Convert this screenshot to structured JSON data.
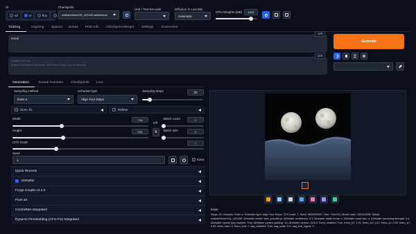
{
  "top": {
    "ui_label": "UI",
    "ui_options": [
      "sd",
      "xl",
      "flux",
      "all"
    ],
    "ui_selected": "xl",
    "checkpoint_label": "Checkpoint",
    "checkpoint_value": "realisticVisionV51_v51VAE.safetensors",
    "vae_label": "VAE / Text Encoder",
    "vae_value": "",
    "diffusion_label": "Diffusion in Low Bits",
    "diffusion_value": "Automatic",
    "gpu_label": "GPU Weights (MB)",
    "gpu_value": "4444",
    "gpu_fraction": 0.85
  },
  "main_tabs": [
    "Txt2img",
    "Img2img",
    "Spaces",
    "Extras",
    "PNG Info",
    "Checkpoint Merger",
    "Settings",
    "Extensions"
  ],
  "main_tab_active": 0,
  "prompt": {
    "value": "moon",
    "counter": "1/75",
    "negative_placeholder": "Negative prompt\n(Press Ctrl+Enter to generate, Alt+Enter to skip, Esc to interrupt)",
    "negative_counter": "0/75"
  },
  "generate_label": "Generate",
  "sub_tabs": [
    "Generation",
    "Textual Inversion",
    "Checkpoints",
    "Lora"
  ],
  "sub_tab_active": 0,
  "sampling": {
    "method_label": "Sampling method",
    "method_value": "Euler a",
    "schedule_label": "Schedule type",
    "schedule_value": "Align Your Steps",
    "steps_label": "Sampling steps",
    "steps_value": "20",
    "steps_fraction": 0.13
  },
  "hires_label": "Hires. fix",
  "refiner_label": "Refiner",
  "width": {
    "label": "Width",
    "value": "744",
    "fraction": 0.36
  },
  "height": {
    "label": "Height",
    "value": "752",
    "fraction": 0.37
  },
  "swap_label": "Off",
  "batch_count": {
    "label": "Batch count",
    "value": "1",
    "fraction": 0.0
  },
  "batch_size": {
    "label": "Batch size",
    "value": "1",
    "fraction": 0.0
  },
  "cfg": {
    "label": "CFG Scale",
    "value": "7",
    "fraction": 0.23
  },
  "seed": {
    "label": "Seed",
    "value": "-1",
    "extra_label": "Extra"
  },
  "accordions": [
    {
      "label": "Quick Recents",
      "checkbox": false
    },
    {
      "label": "ADetailer",
      "checkbox": true
    },
    {
      "label": "Forge Couple v3.2.0",
      "checkbox": false
    },
    {
      "label": "Pixel art",
      "checkbox": false
    },
    {
      "label": "ControlNet Integrated",
      "checkbox": false
    },
    {
      "label": "DynamicThresholding (CFG-Fix) Integrated",
      "checkbox": false
    }
  ],
  "output": {
    "prompt_text": "moon",
    "params_text": "Steps: 20, Sampler: Euler a, Schedule type: Align Your Steps, CFG scale: 7, Seed: 3632950547, Size: 744x752, Model hash: 15012c538f, Model: realisticVisionV51_v51VAE, ADetailer model: face_yolov8n.pt, ADetailer confidence: 0.3, ADetailer dilate erode: 4, ADetailer mask blur: 4, ADetailer denoising strength: 0.4, ADetailer inpaint only masked: True, ADetailer inpaint padding: 32, ADetailer version: 24.6.0, freeu_enabled: True, freeu_b1: 1.01, freeu_b2: 1.02, freeu_s1: 0.99, freeu_s2: 0.95, freeu_start: 0, freeu_end: 1, sag_enabled: True, sag_scale: 0.5, sag_blur_sigma: 2,"
  },
  "icons": {
    "gen_tools": [
      "arrow-icon",
      "trash-icon",
      "list-icon",
      "style-icon"
    ],
    "output_tools": [
      "folder-icon",
      "save-icon",
      "zip-icon",
      "image-icon",
      "palette-icon",
      "extras-icon",
      "grid-icon"
    ]
  },
  "colors": {
    "accent": "#f97316",
    "primary": "#2563eb",
    "bg": "#0b0f19"
  }
}
